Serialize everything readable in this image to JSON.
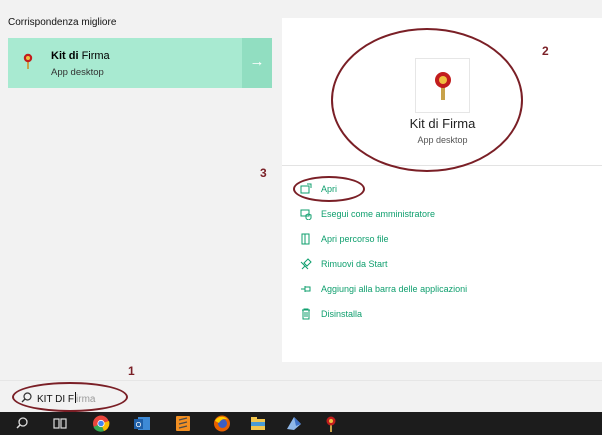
{
  "search_results": {
    "section_header": "Corrispondenza migliore",
    "best_match": {
      "title_bold": "Kit di",
      "title_rest": "Firma",
      "subtitle": "App desktop",
      "arrow": "→",
      "icon": "seal-icon"
    }
  },
  "details": {
    "title": "Kit di Firma",
    "subtitle": "App desktop",
    "icon": "seal-icon",
    "actions": [
      {
        "label": "Apri",
        "icon": "open-icon"
      },
      {
        "label": "Esegui come amministratore",
        "icon": "run-as-admin-icon"
      },
      {
        "label": "Apri percorso file",
        "icon": "file-location-icon"
      },
      {
        "label": "Rimuovi da Start",
        "icon": "unpin-icon"
      },
      {
        "label": "Aggiungi alla barra delle applicazioni",
        "icon": "pin-taskbar-icon"
      },
      {
        "label": "Disinstalla",
        "icon": "trash-icon"
      }
    ]
  },
  "search": {
    "typed_text": "KIT DI F",
    "suggestion_text": "irma",
    "icon": "search-icon"
  },
  "annotations": {
    "n1": "1",
    "n2": "2",
    "n3": "3",
    "color": "#7a1f26"
  },
  "taskbar": {
    "items": [
      "search-icon",
      "task-view-icon",
      "chrome-icon",
      "outlook-icon",
      "sublime-icon",
      "firefox-icon",
      "file-explorer-icon",
      "app-icon",
      "kit-di-firma-icon"
    ]
  },
  "colors": {
    "accent_green": "#0f9f6e",
    "selection_bg": "#a8ead1",
    "taskbar_bg": "#1c1c1c"
  }
}
